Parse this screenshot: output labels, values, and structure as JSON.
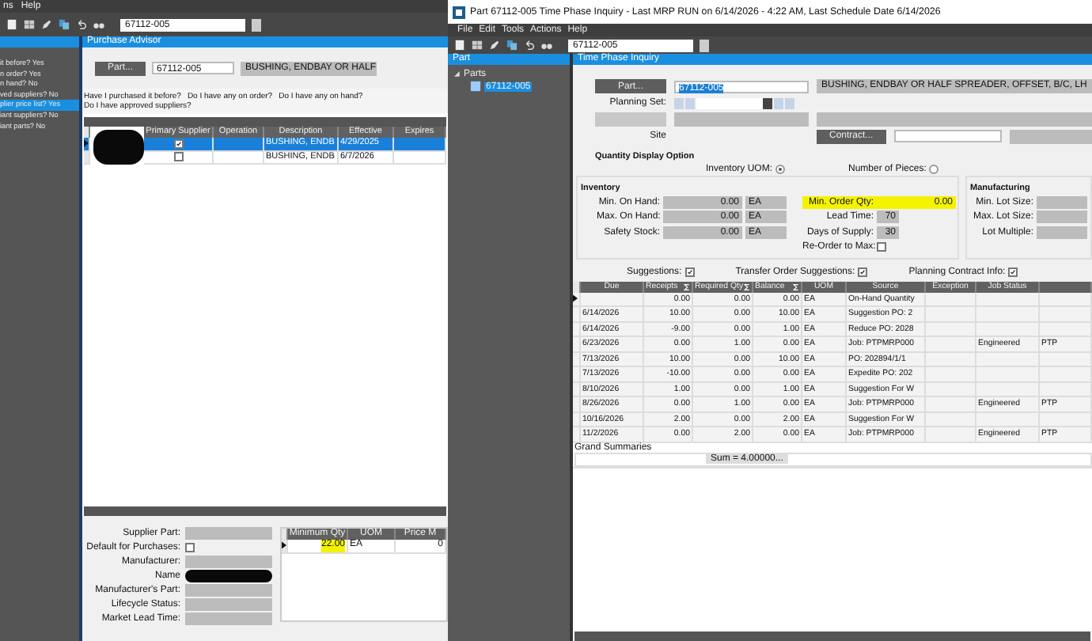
{
  "left_app": {
    "menu": [
      "ns",
      "Help"
    ],
    "part_field": "67112-005",
    "advisor_list": [
      {
        "label": "it before? Yes",
        "selected": false
      },
      {
        "label": "n order? Yes",
        "selected": false
      },
      {
        "label": "n hand? No",
        "selected": false
      },
      {
        "label": "ved suppliers? No",
        "selected": false
      },
      {
        "label": "plier price list? Yes",
        "selected": true
      },
      {
        "label": "iant suppliers? No",
        "selected": false
      },
      {
        "label": "iant parts? No",
        "selected": false
      }
    ]
  },
  "purchase_advisor": {
    "title": "Purchase Advisor",
    "part_button": "Part...",
    "part_field": "67112-005",
    "description": "BUSHING, ENDBAY OR HALF",
    "questions": [
      "Have I purchased it before?",
      "Do I have any on order?",
      "Do I have any on hand?",
      "Do I have approved suppliers?"
    ],
    "supplier_columns": [
      "Primary Supplier",
      "Operation",
      "Description",
      "Effective",
      "Expires"
    ],
    "supplier_rows": [
      {
        "selected": true,
        "primary_supplier": true,
        "description": "BUSHING, ENDB",
        "effective": "4/29/2025"
      },
      {
        "selected": false,
        "primary_supplier": false,
        "description": "BUSHING, ENDB",
        "effective": "6/7/2026"
      }
    ],
    "details": {
      "supplier_part": "Supplier Part:",
      "default_for_purchases": {
        "label": "Default for Purchases:",
        "checked": false
      },
      "labels": [
        "Manufacturer:",
        "Name",
        "Manufacturer's Part:",
        "Lifecycle Status:",
        "Market Lead Time:"
      ]
    },
    "price_columns": [
      "Minimum Qty",
      "UOM",
      "Price M"
    ],
    "price_rows": [
      {
        "minimum_qty": "22.00",
        "uom": "EA",
        "price": "0",
        "highlighted": true
      }
    ]
  },
  "time_phase": {
    "title": "Part 67112-005 Time Phase Inquiry  - Last MRP RUN on 6/14/2026 - 4:22 AM, Last Schedule Date  6/14/2026",
    "menu": [
      "File",
      "Edit",
      "Tools",
      "Actions",
      "Help"
    ],
    "toolbar_field": "67112-005",
    "tree": {
      "header": "Part",
      "root": {
        "label": "Parts",
        "expanded": true,
        "children": [
          {
            "label": "67112-005",
            "selected": true
          }
        ]
      }
    },
    "panel_title": "Time Phase Inquiry",
    "part_button": "Part...",
    "part_field": "67112-005",
    "description": "BUSHING, ENDBAY OR HALF SPREADER, OFFSET, B/C, LH",
    "planning_set_label": "Planning Set:",
    "site_label": "Site",
    "contract_button": "Contract...",
    "display_option": {
      "title": "Quantity Display Option",
      "options": [
        {
          "label": "Inventory UOM:",
          "selected": true
        },
        {
          "label": "Number of Pieces:",
          "selected": false
        }
      ]
    },
    "inventory": {
      "title": "Inventory",
      "rows": [
        {
          "label": "Min. On Hand:",
          "value": "0.00",
          "uom": "EA"
        },
        {
          "label": "Max. On Hand:",
          "value": "0.00",
          "uom": "EA"
        },
        {
          "label": "Safety Stock:",
          "value": "0.00",
          "uom": "EA"
        }
      ],
      "min_order_qty": {
        "label": "Min. Order Qty:",
        "value": "0.00",
        "highlighted": true
      },
      "lead_time": {
        "label": "Lead Time:",
        "value": "70"
      },
      "days_of_supply": {
        "label": "Days of Supply:",
        "value": "30"
      },
      "reorder_to_max": {
        "label": "Re-Order to Max:",
        "checked": false
      }
    },
    "manufacturing": {
      "title": "Manufacturing",
      "labels": [
        "Min. Lot Size:",
        "Max. Lot Size:",
        "Lot Multiple:"
      ]
    },
    "options": [
      {
        "label": "Suggestions:",
        "checked": true
      },
      {
        "label": "Transfer Order Suggestions:",
        "checked": true
      },
      {
        "label": "Planning Contract Info:",
        "checked": true
      }
    ],
    "table": {
      "columns": [
        {
          "label": "Due",
          "sum": false
        },
        {
          "label": "Receipts",
          "sum": true
        },
        {
          "label": "Required Qty",
          "sum": true
        },
        {
          "label": "Balance",
          "sum": true
        },
        {
          "label": "UOM",
          "sum": false
        },
        {
          "label": "Source",
          "sum": false
        },
        {
          "label": "Exception",
          "sum": false
        },
        {
          "label": "Job Status",
          "sum": false
        }
      ],
      "rows": [
        {
          "current": true,
          "cells": [
            "",
            "0.00",
            "0.00",
            "0.00",
            "EA",
            "On-Hand Quantity",
            "",
            "",
            ""
          ]
        },
        {
          "current": false,
          "cells": [
            "6/14/2026",
            "10.00",
            "0.00",
            "10.00",
            "EA",
            "Suggestion PO: 2",
            "",
            "",
            ""
          ]
        },
        {
          "current": false,
          "cells": [
            "6/14/2026",
            "-9.00",
            "0.00",
            "1.00",
            "EA",
            "Reduce PO: 2028",
            "",
            "",
            ""
          ]
        },
        {
          "current": false,
          "cells": [
            "6/23/2026",
            "0.00",
            "1.00",
            "0.00",
            "EA",
            "Job: PTPMRP000",
            "",
            "Engineered",
            "PTP"
          ]
        },
        {
          "current": false,
          "cells": [
            "7/13/2026",
            "10.00",
            "0.00",
            "10.00",
            "EA",
            "PO: 202894/1/1",
            "",
            "",
            ""
          ]
        },
        {
          "current": false,
          "cells": [
            "7/13/2026",
            "-10.00",
            "0.00",
            "0.00",
            "EA",
            "Expedite PO: 202",
            "",
            "",
            ""
          ]
        },
        {
          "current": false,
          "cells": [
            "8/10/2026",
            "1.00",
            "0.00",
            "1.00",
            "EA",
            "Suggestion For W",
            "",
            "",
            ""
          ]
        },
        {
          "current": false,
          "cells": [
            "8/26/2026",
            "0.00",
            "1.00",
            "0.00",
            "EA",
            "Job: PTPMRP000",
            "",
            "Engineered",
            "PTP"
          ]
        },
        {
          "current": false,
          "cells": [
            "10/16/2026",
            "2.00",
            "0.00",
            "2.00",
            "EA",
            "Suggestion For W",
            "",
            "",
            ""
          ]
        },
        {
          "current": false,
          "cells": [
            "11/2/2026",
            "0.00",
            "2.00",
            "0.00",
            "EA",
            "Job: PTPMRP000",
            "",
            "Engineered",
            "PTP"
          ]
        }
      ],
      "summary_title": "Grand Summaries",
      "summary_value": "Sum = 4.00000..."
    }
  }
}
